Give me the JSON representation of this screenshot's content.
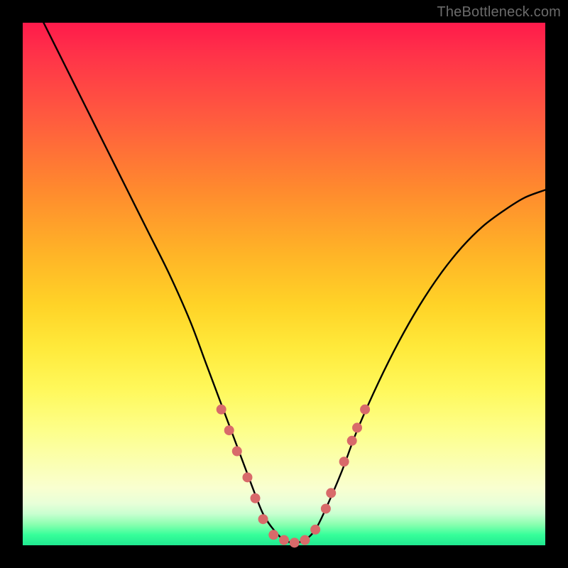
{
  "watermark": "TheBottleneck.com",
  "colors": {
    "frame": "#000000",
    "curve": "#000000",
    "markers": "#d86a6a",
    "gradient_top": "#ff1a4b",
    "gradient_bottom": "#20e890"
  },
  "chart_data": {
    "type": "line",
    "title": "",
    "xlabel": "",
    "ylabel": "",
    "xlim": [
      0,
      100
    ],
    "ylim": [
      0,
      100
    ],
    "curve": {
      "x": [
        4,
        8,
        12,
        16,
        20,
        24,
        28,
        32,
        35,
        38,
        41,
        44,
        46,
        48,
        50,
        52,
        54,
        56,
        58,
        61,
        64,
        68,
        72,
        76,
        80,
        84,
        88,
        92,
        96,
        100
      ],
      "y": [
        100,
        92,
        84,
        76,
        68,
        60,
        52,
        43,
        35,
        27,
        19,
        11,
        6,
        3,
        1,
        0.5,
        1,
        3,
        7,
        14,
        22,
        31,
        39,
        46,
        52,
        57,
        61,
        64,
        66.5,
        68
      ]
    },
    "markers": [
      {
        "x": 38,
        "y": 26
      },
      {
        "x": 39.5,
        "y": 22
      },
      {
        "x": 41,
        "y": 18
      },
      {
        "x": 43,
        "y": 13
      },
      {
        "x": 44.5,
        "y": 9
      },
      {
        "x": 46,
        "y": 5
      },
      {
        "x": 48,
        "y": 2
      },
      {
        "x": 50,
        "y": 1
      },
      {
        "x": 52,
        "y": 0.5
      },
      {
        "x": 54,
        "y": 1
      },
      {
        "x": 56,
        "y": 3
      },
      {
        "x": 58,
        "y": 7
      },
      {
        "x": 59,
        "y": 10
      },
      {
        "x": 61.5,
        "y": 16
      },
      {
        "x": 63,
        "y": 20
      },
      {
        "x": 64,
        "y": 22.5
      },
      {
        "x": 65.5,
        "y": 26
      }
    ]
  }
}
